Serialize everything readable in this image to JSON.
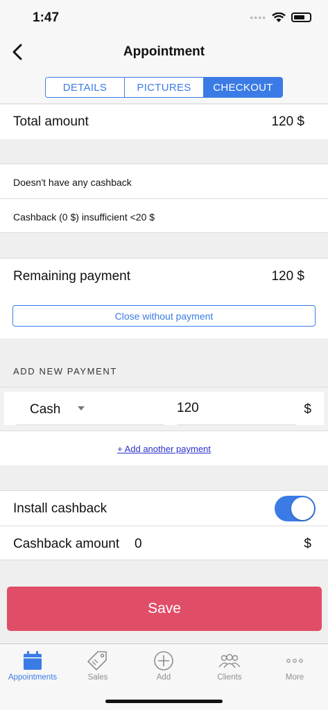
{
  "status_bar": {
    "time": "1:47"
  },
  "nav": {
    "title": "Appointment"
  },
  "tabs": [
    {
      "label": "DETAILS",
      "active": false
    },
    {
      "label": "PICTURES",
      "active": false
    },
    {
      "label": "CHECKOUT",
      "active": true
    }
  ],
  "total": {
    "label": "Total amount",
    "value": "120 $"
  },
  "cashback_info": {
    "line1": "Doesn't have any cashback",
    "line2": "Cashback (0 $) insufficient <20 $"
  },
  "remaining": {
    "label": "Remaining payment",
    "value": "120 $",
    "close_button": "Close without payment"
  },
  "add_payment": {
    "header": "ADD NEW PAYMENT",
    "method": "Cash",
    "amount": "120",
    "currency": "$",
    "add_another_link": "+ Add another payment"
  },
  "install_cashback": {
    "label": "Install cashback",
    "enabled": true
  },
  "cashback_amount": {
    "label": "Cashback amount",
    "value": "0",
    "currency": "$"
  },
  "save_button": "Save",
  "colors": {
    "accent": "#3b7be6",
    "save": "#e04d67",
    "link": "#2a2fcf"
  },
  "tab_bar": [
    {
      "label": "Appointments",
      "icon": "calendar-icon",
      "active": true
    },
    {
      "label": "Sales",
      "icon": "tag-icon",
      "active": false
    },
    {
      "label": "Add",
      "icon": "plus-circle-icon",
      "active": false
    },
    {
      "label": "Clients",
      "icon": "users-icon",
      "active": false
    },
    {
      "label": "More",
      "icon": "more-icon",
      "active": false
    }
  ]
}
